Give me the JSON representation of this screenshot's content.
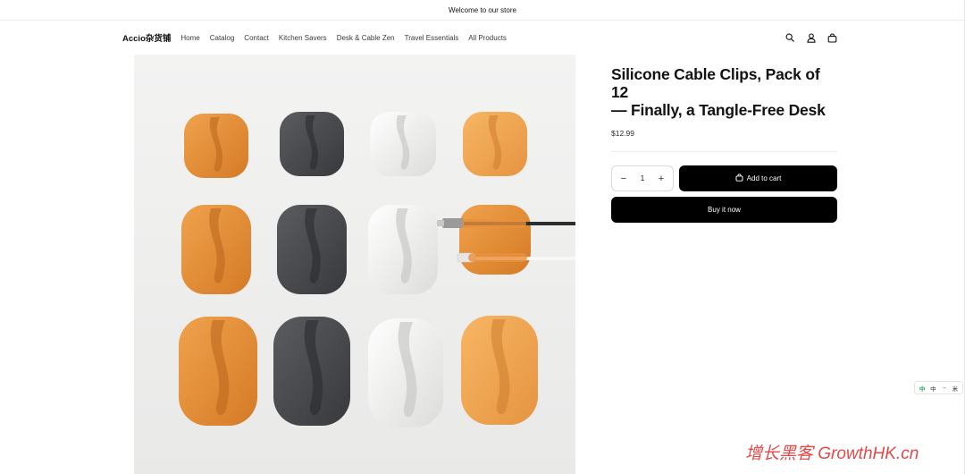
{
  "announcement": {
    "text": "Welcome to our store"
  },
  "header": {
    "logo": "Accio杂货铺",
    "nav": [
      "Home",
      "Catalog",
      "Contact",
      "Kitchen Savers",
      "Desk & Cable Zen",
      "Travel Essentials",
      "All Products"
    ],
    "icons": [
      "search-icon",
      "account-icon",
      "cart-icon"
    ]
  },
  "product": {
    "title_line1": "Silicone Cable Clips, Pack of 12",
    "title_line2": "— Finally, a Tangle-Free Desk",
    "price": "$12.99",
    "quantity": "1",
    "decrease_symbol": "−",
    "increase_symbol": "+",
    "add_to_cart_label": "Add to cart",
    "buy_now_label": "Buy it now"
  },
  "translate_widget": [
    "中",
    "中",
    "→",
    "米"
  ],
  "watermark": "增长黑客 GrowthHK.cn",
  "colors": {
    "clip_orange": "#e8903a",
    "clip_gray": "#4a4c50",
    "clip_white": "#f2f2f0",
    "button_black": "#000000",
    "watermark_red": "#e23a3a"
  }
}
